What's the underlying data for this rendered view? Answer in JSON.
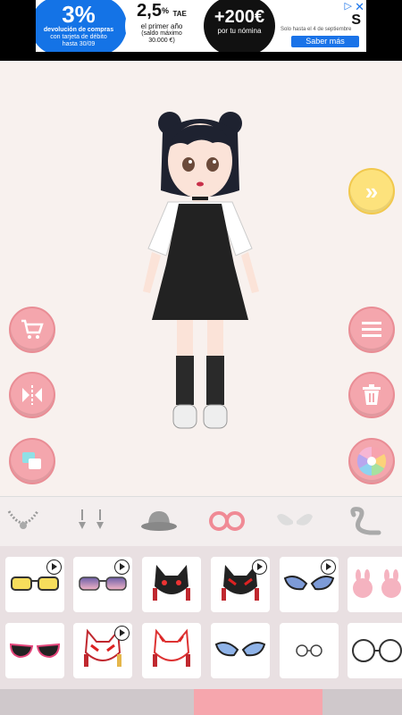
{
  "ad": {
    "blob1_big": "3%",
    "blob1_line1": "devolución de compras",
    "blob1_line2": "con tarjeta de débito",
    "blob1_line3": "hasta 30/09",
    "blob2_big": "2,5",
    "blob2_pct": "%",
    "blob2_tae": "TAE",
    "blob2_line1": "el primer año",
    "blob2_line2": "(saldo máximo",
    "blob2_line3": "30.000 €)",
    "blob3_big": "+200€",
    "blob3_line1": "por tu nómina",
    "right_text": "Solo hasta el 4 de septiembre",
    "cta": "Saber más",
    "brand_letter": "S",
    "close": "✕",
    "adchoices": "▷"
  },
  "stage": {
    "next_icon": "double-chevron-right-icon",
    "left_buttons": [
      "cart-icon",
      "mirror-flip-icon",
      "layers-icon"
    ],
    "right_buttons": [
      "menu-icon",
      "trash-icon",
      "color-palette-icon"
    ]
  },
  "categories": [
    {
      "name": "necklace-icon"
    },
    {
      "name": "earrings-icon"
    },
    {
      "name": "hat-icon"
    },
    {
      "name": "glasses-icon",
      "selected": true
    },
    {
      "name": "wings-icon"
    },
    {
      "name": "tail-icon"
    }
  ],
  "items": [
    {
      "name": "yellow-sunglasses",
      "locked": true
    },
    {
      "name": "pink-gradient-sunglasses",
      "locked": true
    },
    {
      "name": "black-fox-mask",
      "locked": false
    },
    {
      "name": "black-red-fox-mask",
      "locked": true
    },
    {
      "name": "blue-butterfly-glasses",
      "locked": true
    },
    {
      "name": "bunny-glasses",
      "locked": false
    },
    {
      "name": "pink-cat-eye-sunglasses",
      "locked": false
    },
    {
      "name": "white-fox-mask-red",
      "locked": true
    },
    {
      "name": "white-fox-mask",
      "locked": false
    },
    {
      "name": "blue-butterfly-glasses-2",
      "locked": false
    },
    {
      "name": "small-round-glasses",
      "locked": false
    },
    {
      "name": "large-round-glasses",
      "locked": false
    }
  ],
  "colors": {
    "accent": "#f4a6ad",
    "stage_bg": "#f8f1ee",
    "yellow": "#fde27c"
  }
}
